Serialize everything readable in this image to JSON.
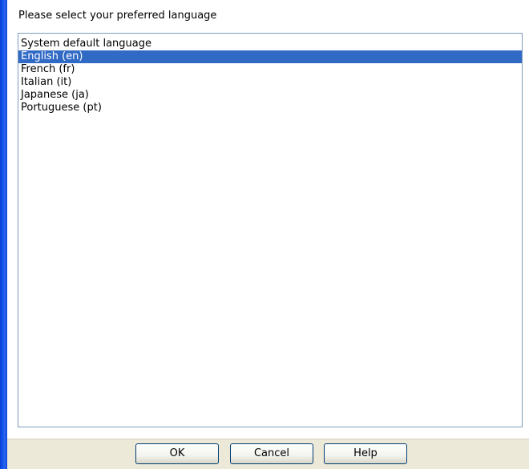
{
  "dialog": {
    "prompt": "Please select your preferred language",
    "languages": [
      {
        "label": "System default language",
        "selected": false
      },
      {
        "label": "English (en)",
        "selected": true
      },
      {
        "label": "French (fr)",
        "selected": false
      },
      {
        "label": "Italian (it)",
        "selected": false
      },
      {
        "label": "Japanese (ja)",
        "selected": false
      },
      {
        "label": "Portuguese (pt)",
        "selected": false
      }
    ]
  },
  "buttons": {
    "ok_label": "OK",
    "cancel_label": "Cancel",
    "help_label": "Help"
  },
  "colors": {
    "selection": "#316ac5",
    "window_border": "#0a3fd6",
    "button_bar": "#ece9d8"
  }
}
